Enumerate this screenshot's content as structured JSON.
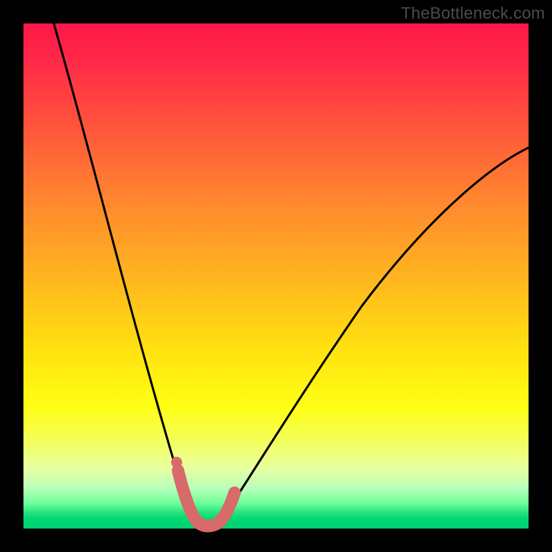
{
  "watermark": "TheBottleneck.com",
  "colors": {
    "frame": "#000000",
    "curve": "#000000",
    "marker": "#d96a6a",
    "gradient_stops": [
      "#ff1649",
      "#ff5a3a",
      "#ffb41f",
      "#feff14",
      "#6dff9a",
      "#00d06e"
    ]
  },
  "chart_data": {
    "type": "line",
    "title": "",
    "xlabel": "",
    "ylabel": "",
    "xlim": [
      0,
      100
    ],
    "ylim": [
      0,
      100
    ],
    "grid": false,
    "legend": false,
    "annotations": [],
    "series": [
      {
        "name": "bottleneck-curve",
        "x": [
          6,
          10,
          14,
          18,
          22,
          26,
          28,
          30,
          32,
          33,
          34,
          35,
          36,
          38,
          40,
          44,
          50,
          58,
          66,
          74,
          82,
          90,
          100
        ],
        "values": [
          100,
          84,
          68,
          52,
          37,
          22,
          15,
          9,
          4,
          2,
          1,
          0.5,
          0.5,
          1,
          2,
          6,
          14,
          26,
          38,
          49,
          58,
          66,
          74
        ]
      }
    ],
    "markers": {
      "name": "highlight-band",
      "x": [
        30,
        31,
        32,
        33,
        34,
        35,
        36,
        37,
        38,
        39
      ],
      "values": [
        9,
        6,
        4,
        2,
        1,
        0.5,
        0.5,
        1,
        2,
        3
      ]
    },
    "minimum_x": 35
  }
}
